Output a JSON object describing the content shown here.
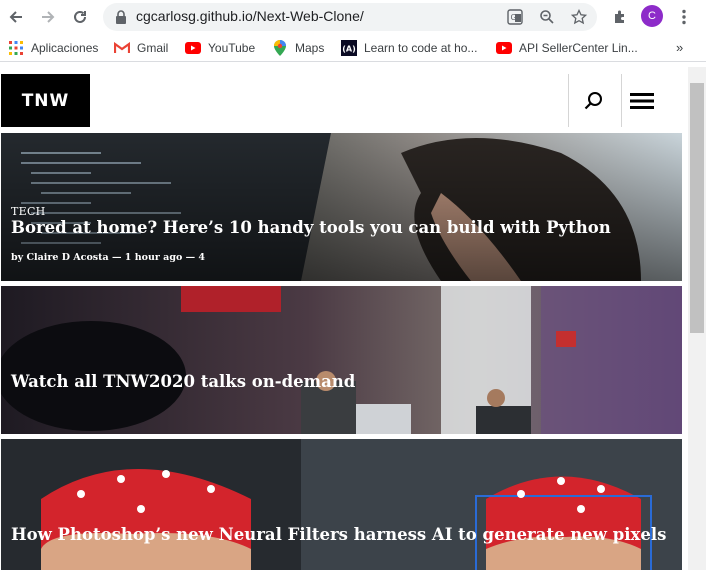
{
  "browser": {
    "url": "cgcarlosg.github.io/Next-Web-Clone/",
    "profile_initial": "C",
    "icons": [
      "back-arrow-icon",
      "forward-arrow-icon",
      "reload-icon",
      "lock-icon",
      "translate-icon",
      "zoom-icon",
      "star-icon",
      "extensions-icon",
      "menu-kebab-icon"
    ]
  },
  "bookmarks": [
    {
      "label": "Aplicaciones",
      "icon": "apps-grid-icon"
    },
    {
      "label": "Gmail",
      "icon": "gmail-icon"
    },
    {
      "label": "YouTube",
      "icon": "youtube-icon"
    },
    {
      "label": "Maps",
      "icon": "maps-icon"
    },
    {
      "label": "Learn to code at ho...",
      "icon": "freecodecamp-icon"
    },
    {
      "label": "API SellerCenter Lin...",
      "icon": "youtube-icon"
    }
  ],
  "bookmarks_more": "»",
  "site": {
    "logo_text": "TNW",
    "articles": [
      {
        "tag": "TECH",
        "title": "Bored at home? Here’s 10 handy tools you can build with Python",
        "byline": "by Claire D Acosta — 1 hour ago — 4"
      },
      {
        "tag": "",
        "title": "Watch all TNW2020 talks on-demand",
        "byline": ""
      },
      {
        "tag": "",
        "title": "How Photoshop’s new Neural Filters harness AI to generate new pixels",
        "byline": ""
      }
    ]
  },
  "colors": {
    "profile": "#8d2bc9",
    "gmail_red": "#ea4335",
    "youtube_red": "#ff0000",
    "logo_bg": "#000000"
  }
}
